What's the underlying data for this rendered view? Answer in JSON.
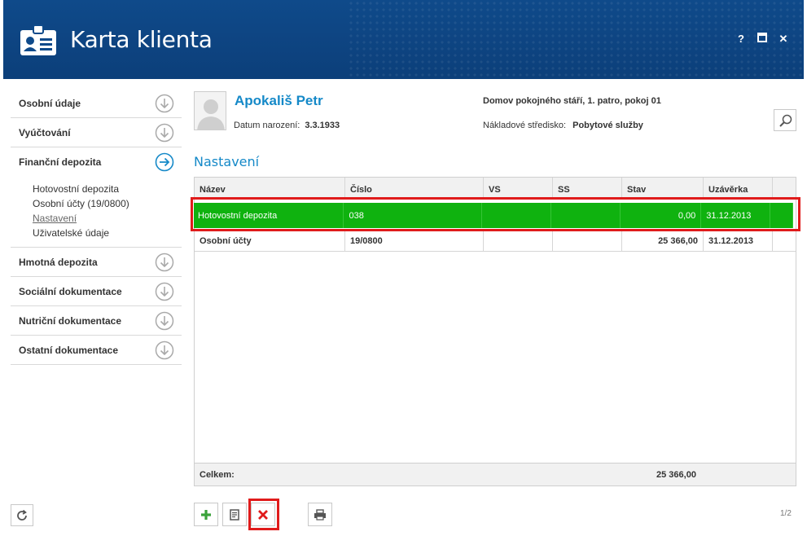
{
  "window": {
    "title": "Karta klienta",
    "buttons": {
      "help": "?",
      "maximize": "▣",
      "close": "✕"
    }
  },
  "sidebar": {
    "items": [
      {
        "label": "Osobní údaje",
        "icon": "arrow-down-circle-icon"
      },
      {
        "label": "Vyúčtování",
        "icon": "arrow-down-circle-icon"
      },
      {
        "label": "Finanční depozita",
        "icon": "arrow-right-circle-icon",
        "expanded": true
      },
      {
        "label": "Hmotná depozita",
        "icon": "arrow-down-circle-icon"
      },
      {
        "label": "Sociální dokumentace",
        "icon": "arrow-down-circle-icon"
      },
      {
        "label": "Nutriční dokumentace",
        "icon": "arrow-down-circle-icon"
      },
      {
        "label": "Ostatní dokumentace",
        "icon": "arrow-down-circle-icon"
      }
    ],
    "subitems": [
      {
        "label": "Hotovostní depozita"
      },
      {
        "label": "Osobní účty (19/0800)"
      },
      {
        "label": "Nastavení",
        "active": true
      },
      {
        "label": "Uživatelské údaje"
      }
    ]
  },
  "client": {
    "name": "Apokališ Petr",
    "dob_label": "Datum narození:",
    "dob_value": "3.3.1933",
    "home": "Domov pokojného stáří, 1. patro, pokoj 01",
    "cost_label": "Nákladové středisko:",
    "cost_value": "Pobytové služby"
  },
  "section": {
    "title": "Nastavení"
  },
  "table": {
    "columns": [
      "Název",
      "Číslo",
      "VS",
      "SS",
      "Stav",
      "Uzávěrka"
    ],
    "rows": [
      {
        "nazev": "Hotovostní depozita",
        "cislo": "038",
        "vs": "",
        "ss": "",
        "stav": "0,00",
        "uzaverka": "31.12.2013",
        "selected": true
      },
      {
        "nazev": "Osobní účty",
        "cislo": "19/0800",
        "vs": "",
        "ss": "",
        "stav": "25 366,00",
        "uzaverka": "31.12.2013",
        "selected": false
      }
    ],
    "footer_label": "Celkem:",
    "footer_total": "25 366,00"
  },
  "toolbar": {
    "add": "+",
    "delete": "✕"
  },
  "pager": "1/2",
  "colors": {
    "header": "#0f4a8a",
    "accent": "#1589c8",
    "selected_row": "#0fb20f",
    "highlight": "#e01b1b"
  }
}
